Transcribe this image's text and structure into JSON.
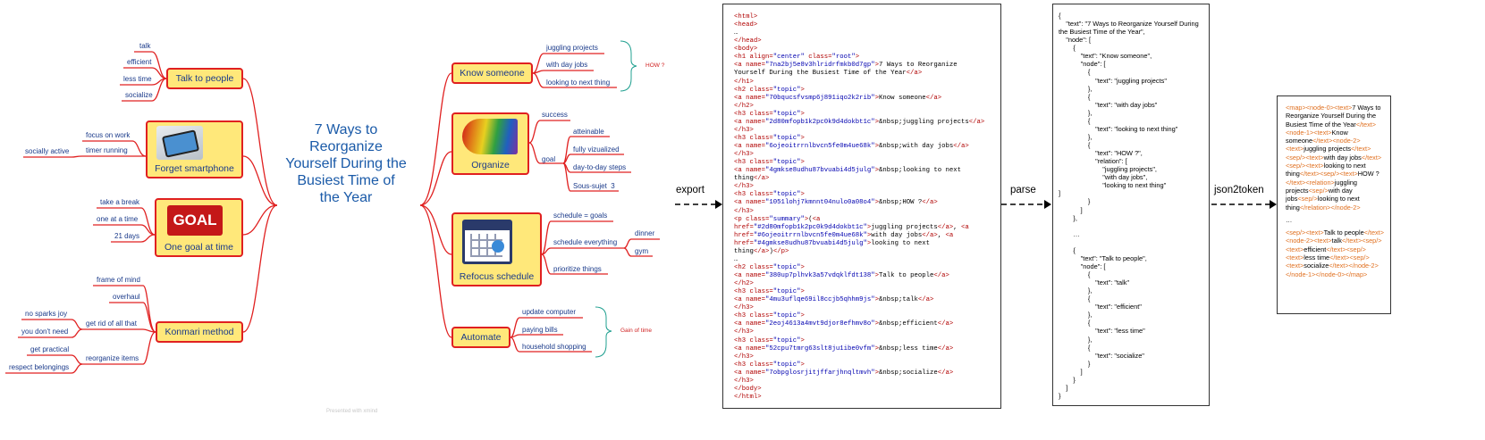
{
  "mindmap": {
    "root_title": "7 Ways to\nReorganize\nYourself During the\nBusiest Time of\nthe Year",
    "footer_text": "Presented with xmind",
    "left": [
      {
        "label": "Talk to people",
        "leaves": [
          "talk",
          "efficient",
          "less time",
          "socialize"
        ]
      },
      {
        "label": "Forget smartphone",
        "image": "smartphone-image",
        "leaves": [
          "focus on work",
          "timer running"
        ],
        "subleaves": [
          "socially active"
        ]
      },
      {
        "label": "One goal at time",
        "image": "goal-logo-image",
        "image_text": "GOAL",
        "leaves": [
          "take a break",
          "one at a time",
          "21 days"
        ]
      },
      {
        "label": "Konmari method",
        "leaves": [
          "frame of mind",
          "overhaul",
          "get rid of all that",
          "reorganize items"
        ],
        "subleaves_rid": [
          "no sparks joy",
          "you don't need"
        ],
        "subleaves_reorg": [
          "get practical",
          "respect belongings"
        ]
      }
    ],
    "right": [
      {
        "label": "Know someone",
        "leaves": [
          "juggling projects",
          "with day jobs",
          "looking to next thing"
        ],
        "annotation": "HOW ?"
      },
      {
        "label": "Organize",
        "image": "color-fan-image",
        "leaves": [
          "success",
          "goal"
        ],
        "subleaves": [
          "atteinable",
          "fully vizualized",
          "day-to-day steps",
          "Sous-sujet  3"
        ]
      },
      {
        "label": "Refocus schedule",
        "image": "calendar-image",
        "leaves": [
          "schedule = goals",
          "schedule everything",
          "prioritize things"
        ],
        "subleaves": [
          "dinner",
          "gym"
        ]
      },
      {
        "label": "Automate",
        "leaves": [
          "update computer",
          "paying bills",
          "household shopping"
        ],
        "annotation": "Gain of time"
      }
    ]
  },
  "pipeline": {
    "export_label": "export",
    "parse_label": "parse",
    "json2token_label": "json2token"
  },
  "html_panel": {
    "lines": [
      "<html>",
      "<head>",
      "…",
      "</head>",
      "<body>",
      "<h1 align=\"center\" class=\"root\">",
      "<a name=\"7na2bj5e8v3hlridrfmkb0d7gp\">7 Ways to Reorganize",
      "Yourself During the Busiest Time of the Year</a>",
      "</h1>",
      "<h2 class=\"topic\">",
      "<a name=\"70bqucsfvsmp6j891iqo2k2rib\">Know someone</a>",
      "</h2>",
      "<h3 class=\"topic\">",
      "<a name=\"2d80mfopb1k2pc0k9d4dokbt1c\">&nbsp;juggling projects</a>",
      "</h3>",
      "<h3 class=\"topic\">",
      "<a name=\"6ojeoitrrnlbvcn5fe0m4ue68k\">&nbsp;with day jobs</a>",
      "</h3>",
      "<h3 class=\"topic\">",
      "<a name=\"4gmkse8udhu87bvuabi4d5julg\">&nbsp;looking to next",
      "thing</a>",
      "</h3>",
      "<h3 class=\"topic\">",
      "<a name=\"1051lohj7kmnnt04nulo0a08o4\">&nbsp;HOW ?</a>",
      "</h3>",
      "<p class=\"summary\">(<a",
      "href=\"#2d80mfopb1k2pc0k9d4dokbt1c\">juggling projects</a>, <a",
      "href=\"#6ojeoitrrnlbvcn5fe0m4ue68k\">with day jobs</a>, <a",
      "href=\"#4gmkse8udhu87bvuabi4d5julg\">looking to next",
      "thing</a>)</p>",
      "…",
      "<h2 class=\"topic\">",
      "<a name=\"380up7plhvk3a57vdqklfdt138\">Talk to people</a>",
      "</h2>",
      "<h3 class=\"topic\">",
      "<a name=\"4mu3uflqe69il8ccjb5qhhm9js\">&nbsp;talk</a>",
      "</h3>",
      "<h3 class=\"topic\">",
      "<a name=\"2eoj4613a4mvt9djor8efhmv8o\">&nbsp;efficient</a>",
      "</h3>",
      "<h3 class=\"topic\">",
      "<a name=\"52cpu7tmrg63slt8ju1ibe0vfm\">&nbsp;less time</a>",
      "</h3>",
      "<h3 class=\"topic\">",
      "<a name=\"7obpglosrjitjffarjhnqltmvh\">&nbsp;socialize</a>",
      "</h3>",
      "</body>",
      "</html>"
    ]
  },
  "json_panel": {
    "lines": [
      "{",
      "    \"text\": \"7 Ways to Reorganize Yourself During",
      "the Busiest Time of the Year\",",
      "    \"node\": [",
      "        {",
      "            \"text\": \"Know someone\",",
      "            \"node\": [",
      "                {",
      "                    \"text\": \"juggling projects\"",
      "                },",
      "                {",
      "                    \"text\": \"with day jobs\"",
      "                },",
      "                {",
      "                    \"text\": \"looking to next thing\"",
      "                },",
      "                {",
      "                    \"text\": \"HOW ?\",",
      "                    \"relation\": [",
      "                        \"juggling projects\",",
      "                        \"with day jobs\",",
      "                        \"looking to next thing\"",
      "]",
      "                }",
      "            ]",
      "        },",
      "",
      "        …",
      "",
      "        {",
      "            \"text\": \"Talk to people\",",
      "            \"node\": [",
      "                {",
      "                    \"text\": \"talk\"",
      "                },",
      "                {",
      "                    \"text\": \"efficient\"",
      "                },",
      "                {",
      "                    \"text\": \"less time\"",
      "                },",
      "                {",
      "                    \"text\": \"socialize\"",
      "                }",
      "            ]",
      "        }",
      "    ]",
      "}"
    ]
  },
  "token_panel": {
    "tokens": [
      {
        "t": "<map>",
        "k": 1
      },
      {
        "t": "<node-0>",
        "k": 1
      },
      {
        "t": "<text>",
        "k": 1
      },
      {
        "t": "7 Ways to Reorganize Yourself During the Busiest Time of the Year",
        "k": 0
      },
      {
        "t": "</text>",
        "k": 1
      },
      {
        "t": "<node-1>",
        "k": 1
      },
      {
        "t": "<text>",
        "k": 1
      },
      {
        "t": "Know someone",
        "k": 0
      },
      {
        "t": "</text>",
        "k": 1
      },
      {
        "t": "<node-2>",
        "k": 1
      },
      {
        "t": "<text>",
        "k": 1
      },
      {
        "t": "juggling projects",
        "k": 0
      },
      {
        "t": "</text>",
        "k": 1
      },
      {
        "t": "<sep/>",
        "k": 1
      },
      {
        "t": "<text>",
        "k": 1
      },
      {
        "t": "with day jobs",
        "k": 0
      },
      {
        "t": "</text>",
        "k": 1
      },
      {
        "t": "<sep/>",
        "k": 1
      },
      {
        "t": "<text>",
        "k": 1
      },
      {
        "t": "looking to next thing",
        "k": 0
      },
      {
        "t": "</text>",
        "k": 1
      },
      {
        "t": "<sep/>",
        "k": 1
      },
      {
        "t": "<text>",
        "k": 1
      },
      {
        "t": "HOW ?",
        "k": 0
      },
      {
        "t": "</text>",
        "k": 1
      },
      {
        "t": "<relation>",
        "k": 1
      },
      {
        "t": "juggling projects",
        "k": 0
      },
      {
        "t": "<sep/>",
        "k": 1
      },
      {
        "t": "with day jobs",
        "k": 0
      },
      {
        "t": "<sep/>",
        "k": 1
      },
      {
        "t": "looking to next thing",
        "k": 0
      },
      {
        "t": "</relation>",
        "k": 1
      },
      {
        "t": "</node-2>",
        "k": 1
      },
      {
        "t": "…",
        "k": 2
      },
      {
        "t": "<sep/>",
        "k": 1
      },
      {
        "t": "<text>",
        "k": 1
      },
      {
        "t": "Talk to people",
        "k": 0
      },
      {
        "t": "</text>",
        "k": 1
      },
      {
        "t": "<node-2>",
        "k": 1
      },
      {
        "t": "<text>",
        "k": 1
      },
      {
        "t": "talk",
        "k": 0
      },
      {
        "t": "</text>",
        "k": 1
      },
      {
        "t": "<sep/>",
        "k": 1
      },
      {
        "t": "<text>",
        "k": 1
      },
      {
        "t": "efficient",
        "k": 0
      },
      {
        "t": "</text>",
        "k": 1
      },
      {
        "t": "<sep/>",
        "k": 1
      },
      {
        "t": "<text>",
        "k": 1
      },
      {
        "t": "less time",
        "k": 0
      },
      {
        "t": "</text>",
        "k": 1
      },
      {
        "t": "<sep/>",
        "k": 1
      },
      {
        "t": "<text>",
        "k": 1
      },
      {
        "t": "socialize",
        "k": 0
      },
      {
        "t": "</text>",
        "k": 1
      },
      {
        "t": "</node-2>",
        "k": 1
      },
      {
        "t": "</node-1>",
        "k": 1
      },
      {
        "t": "</node-0>",
        "k": 1
      },
      {
        "t": "</map>",
        "k": 1
      }
    ]
  },
  "colors": {
    "branch": "#e02020",
    "node_fill": "#ffe87a",
    "text": "#1a3a8a",
    "root_text": "#1a5aa8",
    "summary": "#20a090",
    "token_tag": "#e07020"
  }
}
